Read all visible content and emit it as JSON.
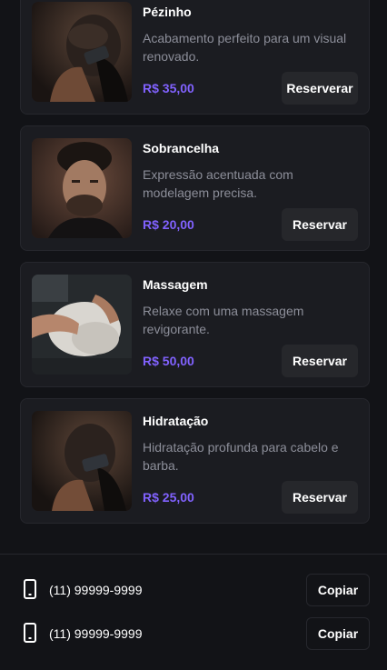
{
  "services": [
    {
      "name": "Pézinho",
      "description": "Acabamento perfeito para um visual renovado.",
      "price": "R$ 35,00",
      "action_label": "Reserverar"
    },
    {
      "name": "Sobrancelha",
      "description": "Expressão acentuada com modelagem precisa.",
      "price": "R$ 20,00",
      "action_label": "Reservar"
    },
    {
      "name": "Massagem",
      "description": "Relaxe com uma massagem revigorante.",
      "price": "R$ 50,00",
      "action_label": "Reservar"
    },
    {
      "name": "Hidratação",
      "description": "Hidratação profunda para cabelo e barba.",
      "price": "R$ 25,00",
      "action_label": "Reservar"
    }
  ],
  "contacts": [
    {
      "phone": "(11) 99999-9999",
      "copy_label": "Copiar",
      "icon": "smartphone-icon"
    },
    {
      "phone": "(11) 99999-9999",
      "copy_label": "Copiar",
      "icon": "smartphone-icon"
    }
  ],
  "colors": {
    "background": "#121317",
    "card": "#1b1c21",
    "price_accent": "#8162ff",
    "muted_text": "#8c8e99"
  }
}
